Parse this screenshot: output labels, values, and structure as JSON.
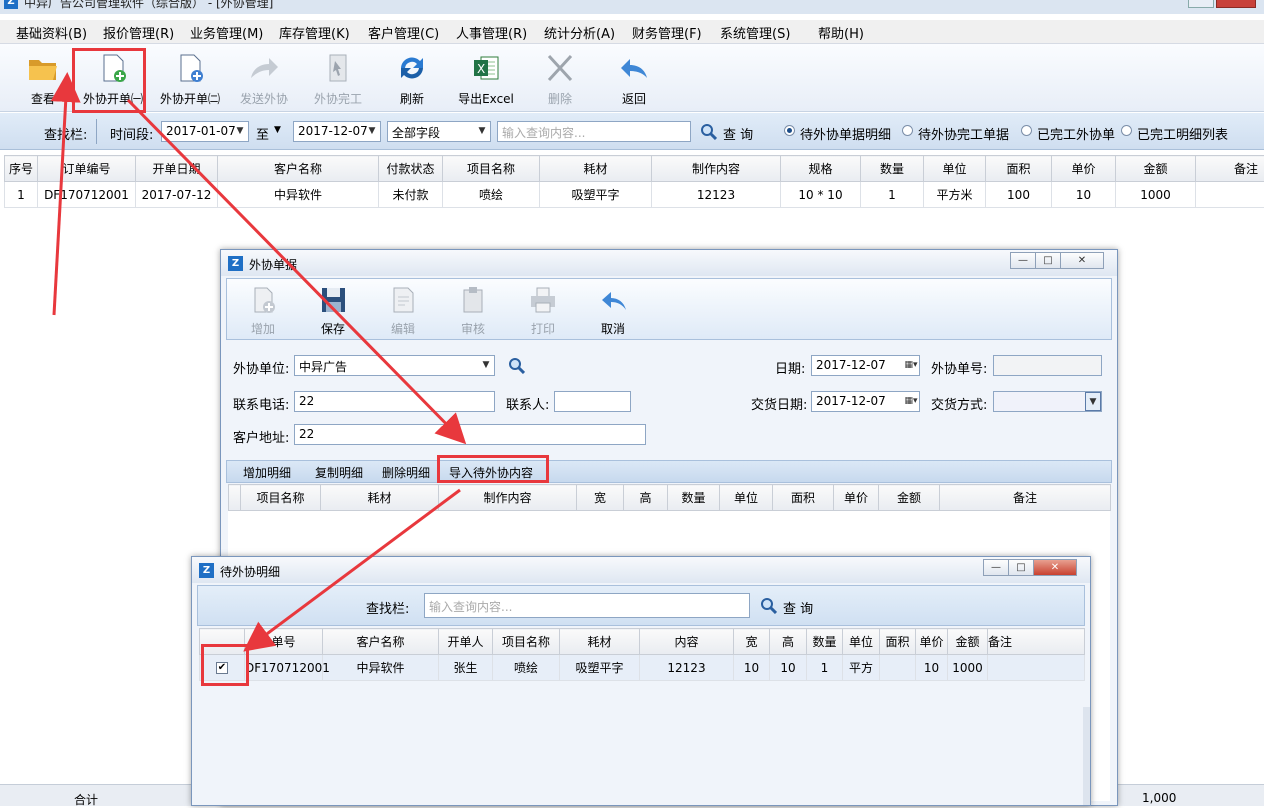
{
  "main_window": {
    "title": "中异广告公司管理软件（综合版） - [外协管理]",
    "menu": [
      "基础资料(B)",
      "报价管理(R)",
      "业务管理(M)",
      "库存管理(K)",
      "客户管理(C)",
      "人事管理(R)",
      "统计分析(A)",
      "财务管理(F)",
      "系统管理(S)",
      "帮助(H)"
    ],
    "toolbar": [
      {
        "label": "查看",
        "icon": "folder-open-icon"
      },
      {
        "label": "外协开单㈠",
        "icon": "new-doc-plus-icon"
      },
      {
        "label": "外协开单㈡",
        "icon": "new-doc-add-icon"
      },
      {
        "label": "发送外协",
        "icon": "forward-arrow-icon"
      },
      {
        "label": "外协完工",
        "icon": "finish-doc-icon"
      },
      {
        "label": "刷新",
        "icon": "refresh-icon"
      },
      {
        "label": "导出Excel",
        "icon": "excel-icon"
      },
      {
        "label": "删除",
        "icon": "delete-x-icon"
      },
      {
        "label": "返回",
        "icon": "back-arrow-icon"
      }
    ],
    "query": {
      "label": "查找栏:",
      "period_label": "时间段:",
      "date_from": "2017-01-07",
      "to_label": "至",
      "date_to": "2017-12-07",
      "field": "全部字段",
      "search_placeholder": "输入查询内容...",
      "search_button": "查 询",
      "radios": [
        "待外协单据明细",
        "待外协完工单据",
        "已完工外协单",
        "已完工明细列表"
      ]
    },
    "table": {
      "headers": [
        "序号",
        "订单编号",
        "开单日期",
        "客户名称",
        "付款状态",
        "项目名称",
        "耗材",
        "制作内容",
        "规格",
        "数量",
        "单位",
        "面积",
        "单价",
        "金额",
        "备注"
      ],
      "rows": [
        [
          "1",
          "DF170712001",
          "2017-07-12",
          "中异软件",
          "未付款",
          "喷绘",
          "吸塑平字",
          "12123",
          "10 * 10",
          "1",
          "平方米",
          "100",
          "10",
          "1000",
          ""
        ]
      ]
    },
    "footer": {
      "total_label": "合计",
      "total_value": "1,000"
    }
  },
  "dialog_outsource": {
    "title": "外协单据",
    "toolbar": [
      {
        "label": "增加",
        "icon": "add-doc-icon"
      },
      {
        "label": "保存",
        "icon": "save-disk-icon"
      },
      {
        "label": "编辑",
        "icon": "edit-doc-icon"
      },
      {
        "label": "审核",
        "icon": "audit-clipboard-icon"
      },
      {
        "label": "打印",
        "icon": "printer-icon"
      },
      {
        "label": "取消",
        "icon": "undo-arrow-icon"
      }
    ],
    "form": {
      "unit_label": "外协单位:",
      "unit_value": "中异广告",
      "date_label": "日期:",
      "date_value": "2017-12-07",
      "no_label": "外协单号:",
      "no_value": "",
      "phone_label": "联系电话:",
      "phone_value": "22",
      "contact_label": "联系人:",
      "contact_value": "",
      "delivery_label": "交货日期:",
      "delivery_value": "2017-12-07",
      "method_label": "交货方式:",
      "method_value": "",
      "address_label": "客户地址:",
      "address_value": "22"
    },
    "tabs": [
      "增加明细",
      "复制明细",
      "删除明细",
      "导入待外协内容"
    ],
    "headers": [
      "项目名称",
      "耗材",
      "制作内容",
      "宽",
      "高",
      "数量",
      "单位",
      "面积",
      "单价",
      "金额",
      "备注"
    ]
  },
  "dialog_pending": {
    "title": "待外协明细",
    "query_label": "查找栏:",
    "search_placeholder": "输入查询内容...",
    "search_button": "查 询",
    "headers": [
      "单号",
      "客户名称",
      "开单人",
      "项目名称",
      "耗材",
      "内容",
      "宽",
      "高",
      "数量",
      "单位",
      "面积",
      "单价",
      "金额",
      "备注"
    ],
    "rows": [
      [
        "DF170712001",
        "中异软件",
        "张生",
        "喷绘",
        "吸塑平字",
        "12123",
        "10",
        "10",
        "1",
        "平方",
        "",
        "10",
        "1000",
        ""
      ]
    ]
  },
  "colors": {
    "accent": "#1f6fc5",
    "highlight_red": "#e8383d",
    "query_bg": "#d8e6f5"
  }
}
